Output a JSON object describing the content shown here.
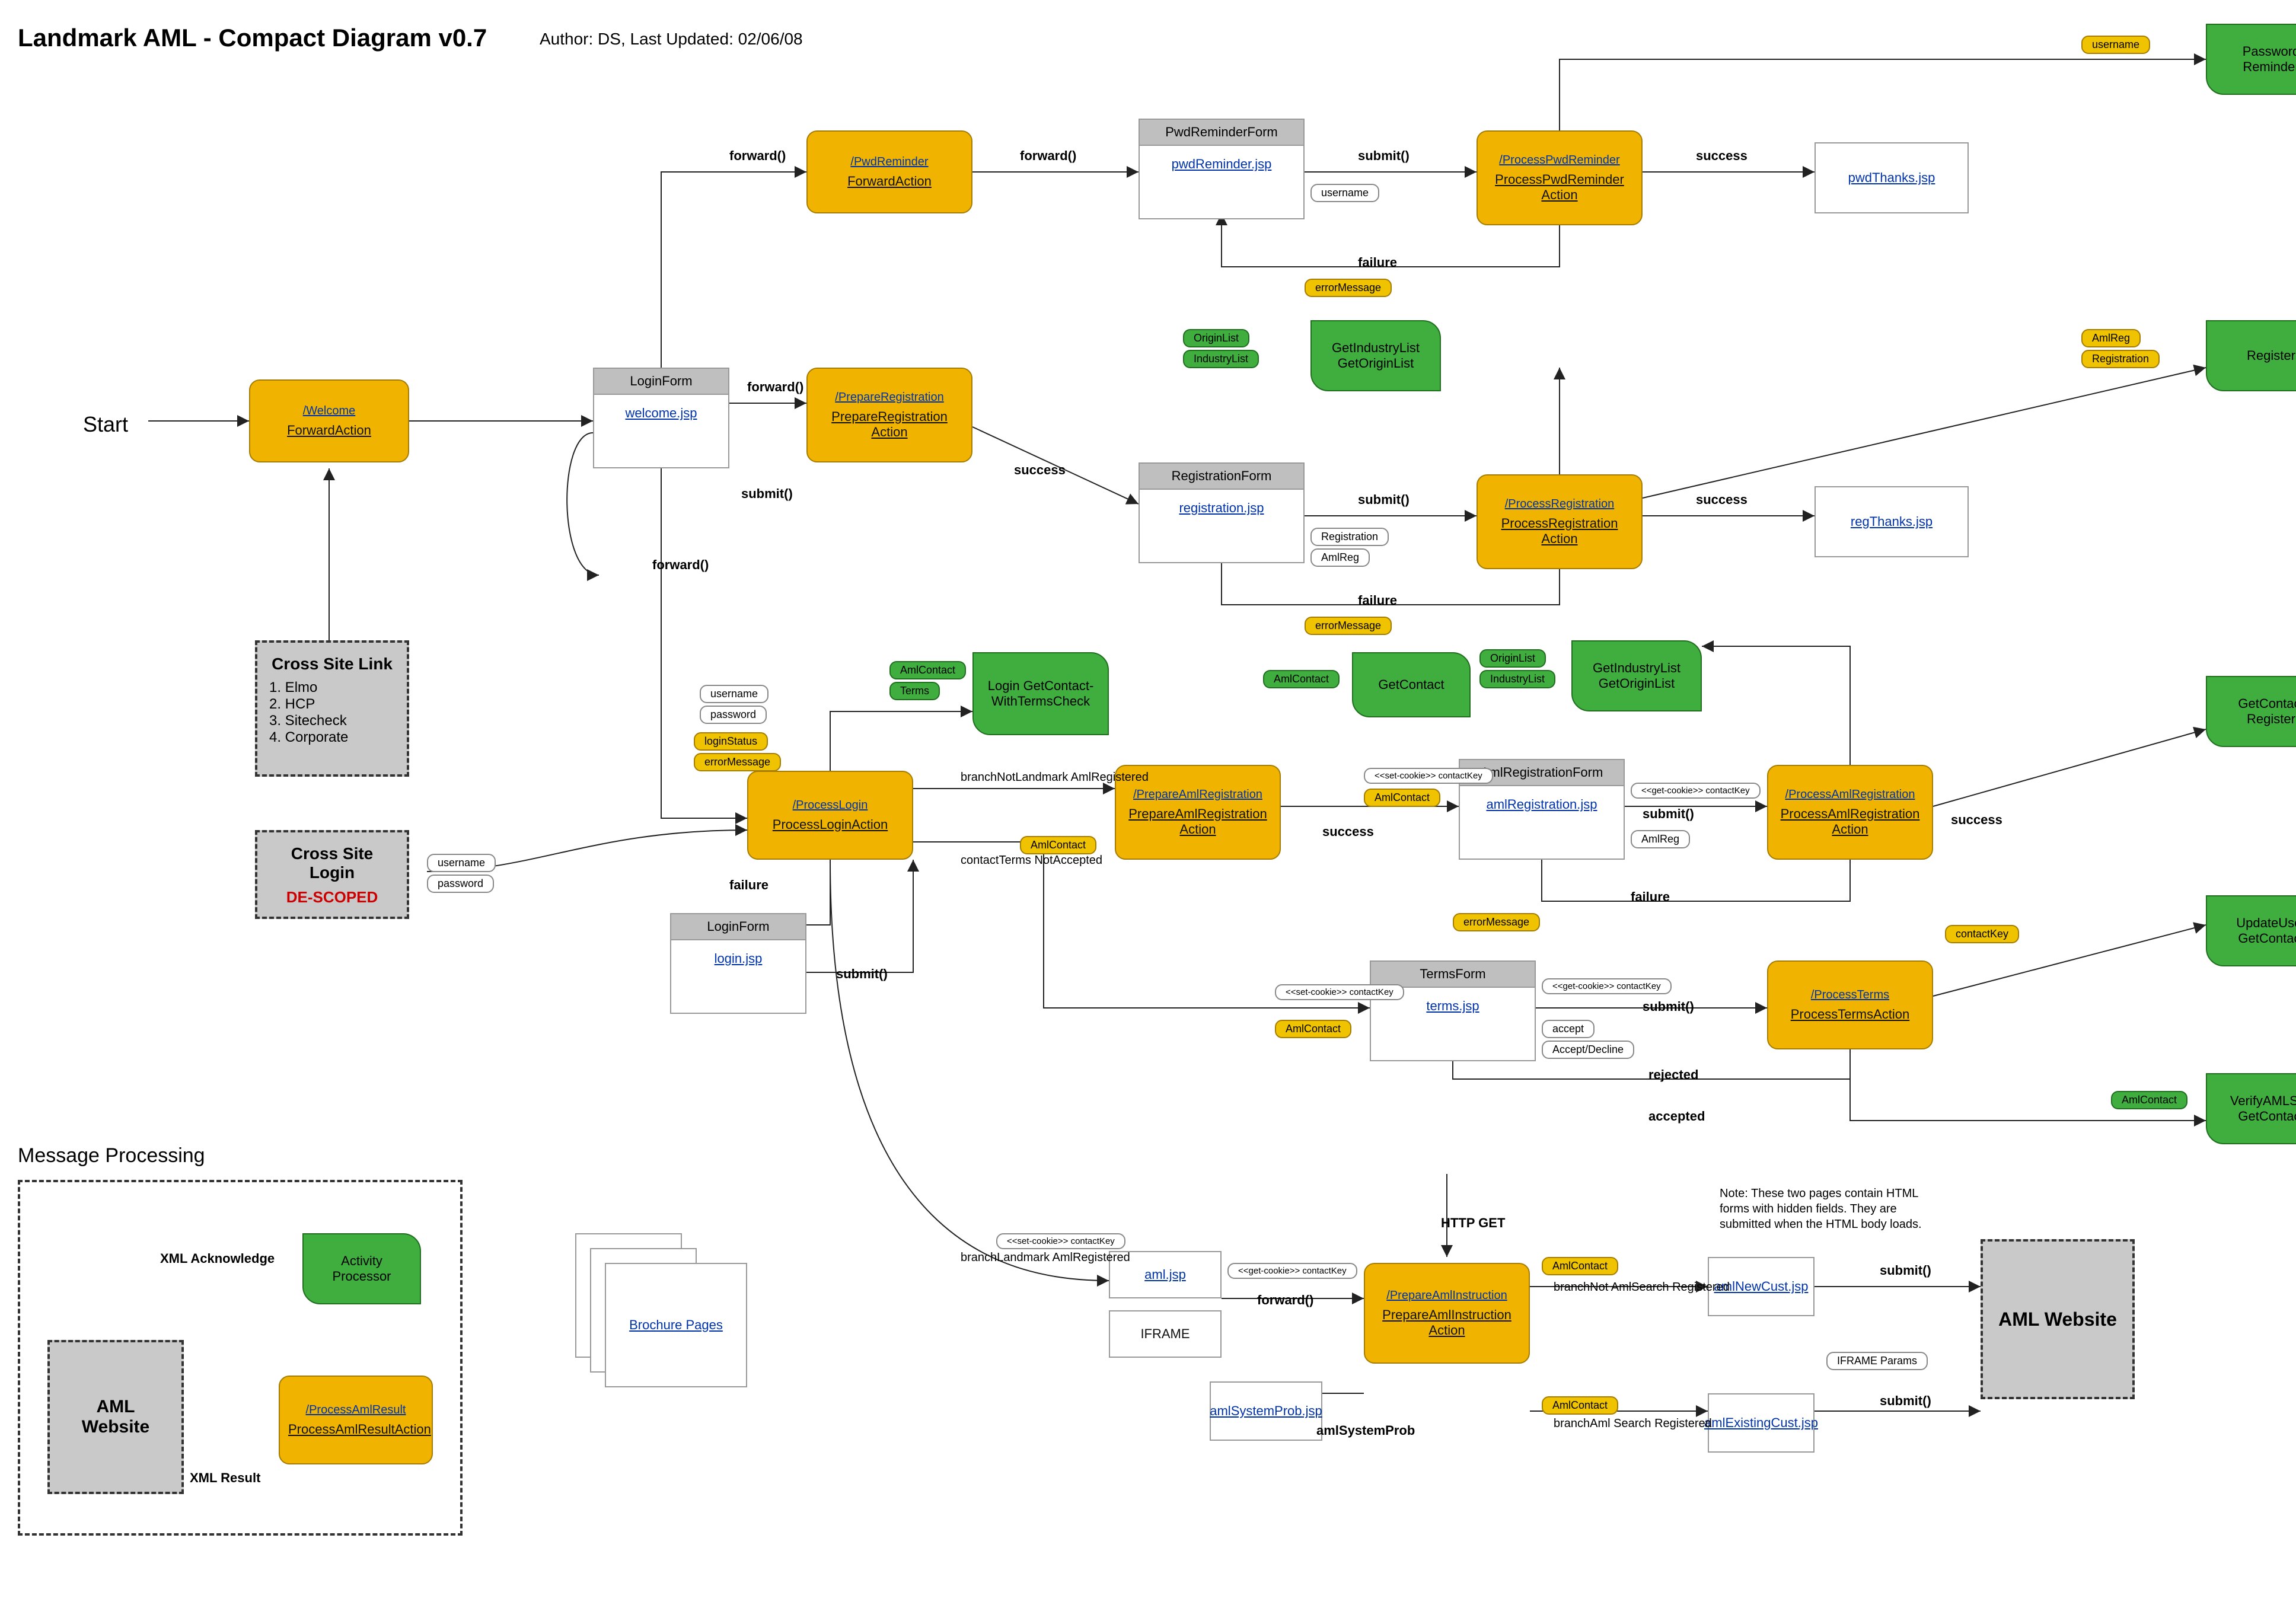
{
  "header": {
    "title": "Landmark AML - Compact Diagram v0.7",
    "author_line": "Author: DS, Last Updated: 02/06/08"
  },
  "start_label": "Start",
  "section_msgproc": "Message Processing",
  "actions": {
    "welcome": {
      "path": "/Welcome",
      "name": "ForwardAction"
    },
    "pwdReminder": {
      "path": "/PwdReminder",
      "name": "ForwardAction"
    },
    "prepReg": {
      "path": "/PrepareRegistration",
      "name": "PrepareRegistration Action"
    },
    "procPwd": {
      "path": "/ProcessPwdReminder",
      "name": "ProcessPwdReminder Action"
    },
    "procReg": {
      "path": "/ProcessRegistration",
      "name": "ProcessRegistration Action"
    },
    "procLogin": {
      "path": "/ProcessLogin",
      "name": "ProcessLoginAction"
    },
    "prepAmlReg": {
      "path": "/PrepareAmlRegistration",
      "name": "PrepareAmlRegistration Action"
    },
    "procAmlReg": {
      "path": "/ProcessAmlRegistration",
      "name": "ProcessAmlRegistration Action"
    },
    "procTerms": {
      "path": "/ProcessTerms",
      "name": "ProcessTermsAction"
    },
    "prepAmlInstr": {
      "path": "/PrepareAmlInstruction",
      "name": "PrepareAmlInstruction Action"
    },
    "procAmlResult": {
      "path": "/ProcessAmlResult",
      "name": "ProcessAmlResultAction"
    }
  },
  "forms": {
    "login": {
      "title": "LoginForm",
      "page": "welcome.jsp"
    },
    "pwdReminder": {
      "title": "PwdReminderForm",
      "page": "pwdReminder.jsp"
    },
    "registration": {
      "title": "RegistrationForm",
      "page": "registration.jsp"
    },
    "amlReg": {
      "title": "AmlRegistrationForm",
      "page": "amlRegistration.jsp"
    },
    "login2": {
      "title": "LoginForm",
      "page": "login.jsp"
    },
    "terms": {
      "title": "TermsForm",
      "page": "terms.jsp"
    }
  },
  "pages": {
    "pwdThanks": "pwdThanks.jsp",
    "regThanks": "regThanks.jsp",
    "brochure": "Brochure Pages",
    "aml": "aml.jsp",
    "iframe": "IFRAME",
    "systemProb": "amlSystemProb.jsp",
    "newCust": "amlNewCust.jsp",
    "exCust": "amlExistingCust.jsp"
  },
  "services": {
    "pwdReminder": "Password Reminder",
    "getIndustry": "GetIndustryList GetOriginList",
    "register": "Register",
    "loginCheck": "Login GetContact-WithTermsCheck",
    "getContact": "GetContact",
    "getIndustry2": "GetIndustryList GetOriginList",
    "getContactReg": "GetContact Register",
    "updateUser": "UpdateUser GetContact",
    "verifySite": "VerifyAMLSite GetContact",
    "activityProc": "Activity Processor"
  },
  "edges": {
    "forward": "forward()",
    "submit": "submit()",
    "success": "success",
    "failure": "failure",
    "branchNotLandmarkAmlRegistered": "branchNotLandmark AmlRegistered",
    "branchLandmarkAmlRegistered": "branchLandmark AmlRegistered",
    "contactTermsNotAccepted": "contactTerms NotAccepted",
    "accepted": "accepted",
    "rejected": "rejected",
    "httpGet": "HTTP GET",
    "amlSystemProb": "amlSystemProb",
    "branchNotAmlSearchRegistered": "branchNot AmlSearch Registered",
    "branchAmlSearchRegistered": "branchAml Search Registered",
    "xmlAck": "XML Acknowledge",
    "xmlResult": "XML Result"
  },
  "tags": {
    "username": "username",
    "password": "password",
    "errorMessage": "errorMessage",
    "loginStatus": "loginStatus",
    "originList": "OriginList",
    "industryList": "IndustryList",
    "registration": "Registration",
    "amlReg": "AmlReg",
    "amlContact": "AmlContact",
    "terms": "Terms",
    "contactKey": "contactKey",
    "setCookieContactKey": "<<set-cookie>> contactKey",
    "getCookieContactKey": "<<get-cookie>> contactKey",
    "accept": "accept",
    "acceptDecline": "Accept/Decline",
    "iframeParams": "IFRAME Params"
  },
  "boxes": {
    "crossSiteLink": {
      "title": "Cross Site Link",
      "items": [
        "1. Elmo",
        "2. HCP",
        "3. Sitecheck",
        "4. Corporate"
      ]
    },
    "crossSiteLogin": {
      "title": "Cross Site Login",
      "sub": "DE-SCOPED"
    },
    "amlWebsite": "AML Website",
    "note": "Note: These two pages contain HTML forms with hidden fields. They are submitted when the HTML body loads."
  }
}
